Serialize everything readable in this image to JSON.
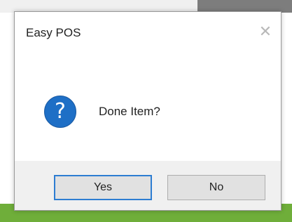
{
  "dialog": {
    "title": "Easy POS",
    "close_icon": "close-icon",
    "message": "Done Item?",
    "icon": "question-icon",
    "icon_glyph": "?",
    "buttons": {
      "yes_label": "Yes",
      "no_label": "No"
    }
  },
  "colors": {
    "icon_blue": "#1e6fc6",
    "focus_border": "#2d7dd2",
    "button_bar": "#f0f0f0"
  }
}
